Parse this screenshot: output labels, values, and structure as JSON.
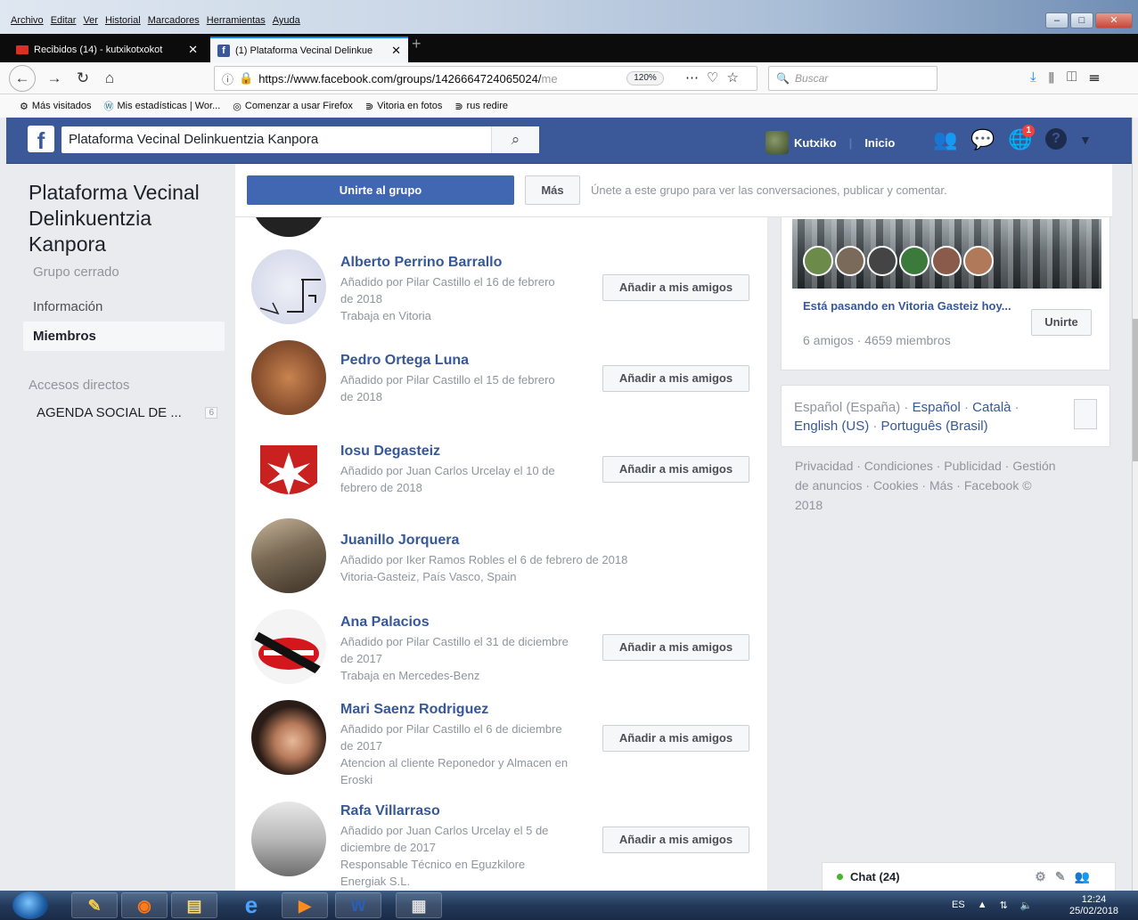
{
  "menu": [
    "Archivo",
    "Editar",
    "Ver",
    "Historial",
    "Marcadores",
    "Herramientas",
    "Ayuda"
  ],
  "tabs": [
    {
      "title": "Recibidos (14) - kutxikotxokot",
      "active": false
    },
    {
      "title": "(1) Plataforma Vecinal Delinkue",
      "active": true
    }
  ],
  "address": {
    "url": "https://www.facebook.com/groups/1426664724065024/",
    "url_tail": "me",
    "zoom": "120%"
  },
  "search": {
    "placeholder": "Buscar"
  },
  "bookmarks": [
    "Más visitados",
    "Mis estadísticas | Wor...",
    "Comenzar a usar Firefox",
    "Vitoria en fotos",
    "rus redire"
  ],
  "fb": {
    "search_value": "Plataforma Vecinal Delinkuentzia Kanpora",
    "user": "Kutxiko",
    "home": "Inicio",
    "notif_badge": "1",
    "help": "?"
  },
  "left": {
    "title": "Plataforma Vecinal Delinkuentzia Kanpora",
    "type": "Grupo cerrado",
    "nav": [
      "Información",
      "Miembros"
    ],
    "shortcuts_header": "Accesos directos",
    "shortcut": {
      "label": "AGENDA SOCIAL DE ...",
      "count": "6"
    }
  },
  "actionbar": {
    "join": "Unirte al grupo",
    "more": "Más",
    "hint": "Únete a este grupo para ver las conversaciones, publicar y comentar."
  },
  "members_add_label": "Añadir a mis amigos",
  "members": [
    {
      "name": "Alberto Perrino Barrallo",
      "lines": [
        "Añadido por Pilar Castillo el 16 de febrero",
        "de 2018",
        "Trabaja en Vitoria"
      ],
      "button": true
    },
    {
      "name": "Pedro Ortega Luna",
      "lines": [
        "Añadido por Pilar Castillo el 15 de febrero",
        "de 2018"
      ],
      "button": true
    },
    {
      "name": "Iosu Degasteiz",
      "lines": [
        "Añadido por Juan Carlos Urcelay el 10 de",
        "febrero de 2018"
      ],
      "button": true
    },
    {
      "name": "Juanillo Jorquera",
      "lines": [
        "Añadido por Iker Ramos Robles el 6 de febrero de 2018",
        "Vitoria-Gasteiz, País Vasco, Spain"
      ],
      "button": false
    },
    {
      "name": "Ana Palacios",
      "lines": [
        "Añadido por Pilar Castillo el 31 de diciembre",
        "de 2017",
        "Trabaja en Mercedes-Benz"
      ],
      "button": true
    },
    {
      "name": "Mari Saenz Rodriguez",
      "lines": [
        "Añadido por Pilar Castillo el 6 de diciembre",
        "de 2017",
        "Atencion al cliente Reponedor y Almacen en",
        "Eroski"
      ],
      "button": true
    },
    {
      "name": "Rafa Villarraso",
      "lines": [
        "Añadido por Juan Carlos Urcelay el 5 de",
        "diciembre de 2017",
        "Responsable Técnico en Eguzkilore",
        "Energiak S.L."
      ],
      "button": true
    }
  ],
  "right": {
    "happening": "Está pasando en Vitoria Gasteiz hoy...",
    "join": "Unirte",
    "stats": "6 amigos · 4659 miembros",
    "languages": {
      "current": "Español (España)",
      "others": [
        "Español",
        "Català",
        "English (US)",
        "Português (Brasil)"
      ]
    },
    "footer": "Privacidad · Condiciones · Publicidad · Gestión de anuncios · Cookies · Más · Facebook © 2018"
  },
  "chat": {
    "label": "Chat (24)"
  },
  "taskbar": {
    "lang": "ES",
    "time": "12:24",
    "date": "25/02/2018"
  },
  "colors": {
    "fb_blue": "#3b5998",
    "join_blue": "#4267b2",
    "link": "#365899",
    "online": "#42b72a"
  }
}
